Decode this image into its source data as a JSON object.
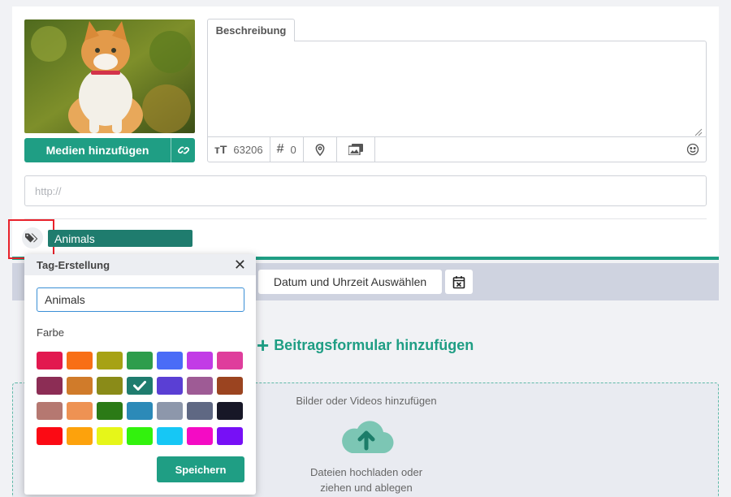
{
  "media": {
    "add_label": "Medien hinzufügen",
    "link_icon": "link-icon"
  },
  "description": {
    "tab_label": "Beschreibung",
    "value": ""
  },
  "toolbar": {
    "char_count": "63206",
    "hashtag_count": "0"
  },
  "url": {
    "placeholder": "http://"
  },
  "tags": {
    "selected_tag": "Animals"
  },
  "schedule": {
    "date_button_label": "Datum und Uhrzeit Auswählen"
  },
  "add_form": {
    "label": "Beitragsformular hinzufügen"
  },
  "dropzone": {
    "title": "Bilder oder Videos hinzufügen",
    "line1": "Dateien hochladen oder",
    "line2": "ziehen und ablegen"
  },
  "tag_popup": {
    "title": "Tag-Erstellung",
    "name_value": "Animals",
    "color_label": "Farbe",
    "save_label": "Speichern",
    "selected_index": 10,
    "colors": [
      "#e2184f",
      "#f86f16",
      "#a7a214",
      "#2e9d4c",
      "#4a6cf7",
      "#c23be6",
      "#df3d9c",
      "#8c2d55",
      "#d07b2a",
      "#8a8b18",
      "#1f7c6e",
      "#5a3fd4",
      "#9e5b95",
      "#9b4420",
      "#b57871",
      "#ee9253",
      "#2b7a16",
      "#2c8ab8",
      "#8d97ab",
      "#5f6883",
      "#171727",
      "#fb0a14",
      "#fda20c",
      "#e6f619",
      "#32f20d",
      "#16c7f5",
      "#f40bc4",
      "#7710f6"
    ]
  },
  "accent_color": "#1f9e84",
  "highlight_color": "#e8222b"
}
